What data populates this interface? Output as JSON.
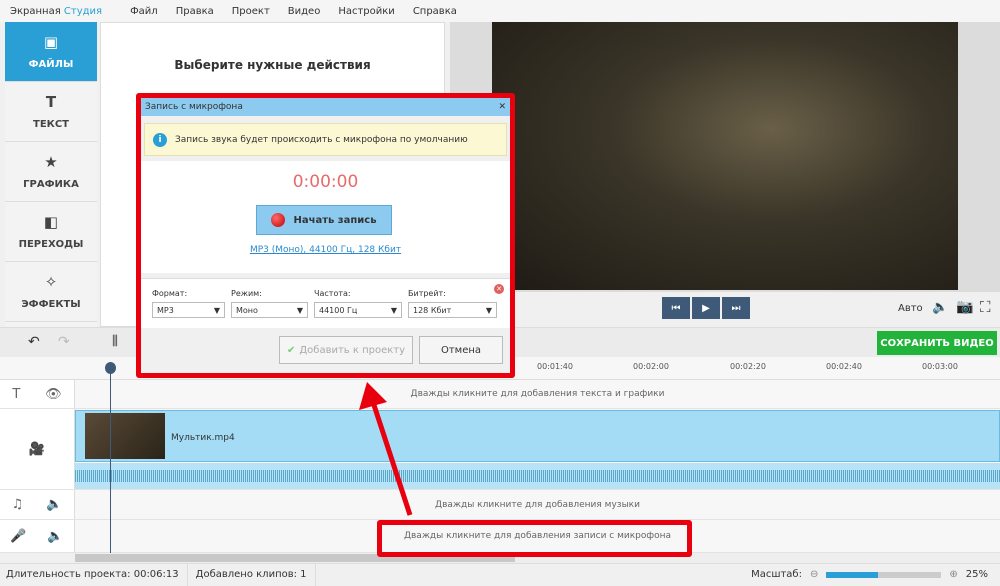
{
  "app": {
    "brand_1": "Экранная",
    "brand_2": "Студия"
  },
  "menu": [
    "Файл",
    "Правка",
    "Проект",
    "Видео",
    "Настройки",
    "Справка"
  ],
  "sidebar": [
    {
      "label": "ФАЙЛЫ",
      "icon": "image-icon"
    },
    {
      "label": "ТЕКСТ",
      "icon": "text-icon"
    },
    {
      "label": "ГРАФИКА",
      "icon": "star-icon"
    },
    {
      "label": "ПЕРЕХОДЫ",
      "icon": "transitions-icon"
    },
    {
      "label": "ЭФФЕКТЫ",
      "icon": "magic-wand-icon"
    }
  ],
  "panel": {
    "title": "Выберите нужные действия"
  },
  "player": {
    "quality": "Авто"
  },
  "toolbar": {
    "save": "СОХРАНИТЬ ВИДЕО"
  },
  "ruler": [
    "00:01:40",
    "00:02:00",
    "00:02:20",
    "00:02:40",
    "00:03:00"
  ],
  "tracks": {
    "text_hint": "Дважды кликните для добавления текста и графики",
    "clip_name": "Мультик.mp4",
    "music_hint": "Дважды кликните для добавления музыки",
    "mic_hint": "Дважды кликните для добавления записи с микрофона"
  },
  "status": {
    "duration": "Длительность проекта: 00:06:13",
    "clips": "Добавлено клипов: 1",
    "zoom_label": "Масштаб:",
    "zoom_value": "25%",
    "zoom_fraction": 0.45
  },
  "dialog": {
    "title": "Запись с микрофона",
    "info": "Запись звука будет происходить с микрофона по умолчанию",
    "timer": "0:00:00",
    "record": "Начать запись",
    "link": "MP3 (Моно), 44100 Гц, 128 Кбит",
    "fields": [
      {
        "label": "Формат:",
        "value": "MP3"
      },
      {
        "label": "Режим:",
        "value": "Моно"
      },
      {
        "label": "Частота:",
        "value": "44100 Гц"
      },
      {
        "label": "Битрейт:",
        "value": "128 Кбит"
      }
    ],
    "add": "Добавить к проекту",
    "cancel": "Отмена"
  }
}
